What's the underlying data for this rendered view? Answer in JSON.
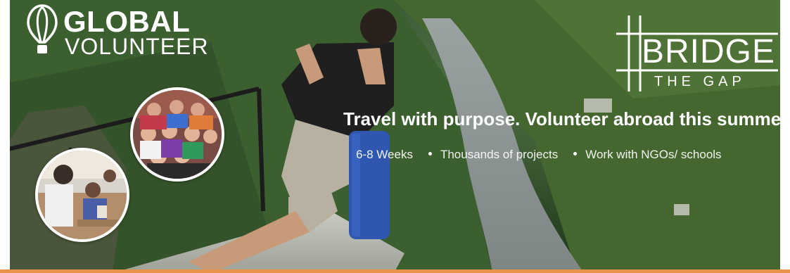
{
  "brand": {
    "name_line1": "GLOBAL",
    "name_line2": "VOLUNTEER"
  },
  "partner_logo": {
    "line1": "BRIDGE",
    "line2": "THE GAP"
  },
  "headline": "Travel with purpose. Volunteer abroad this summer",
  "features": [
    "6-8 Weeks",
    "Thousands of projects",
    "Work with NGOs/ schools"
  ],
  "colors": {
    "text": "#ffffff",
    "bottom_bar": "#e8914a"
  },
  "icons": {
    "brand_mark": "balloon-icon",
    "partner_mark": "hashtag-icon"
  }
}
